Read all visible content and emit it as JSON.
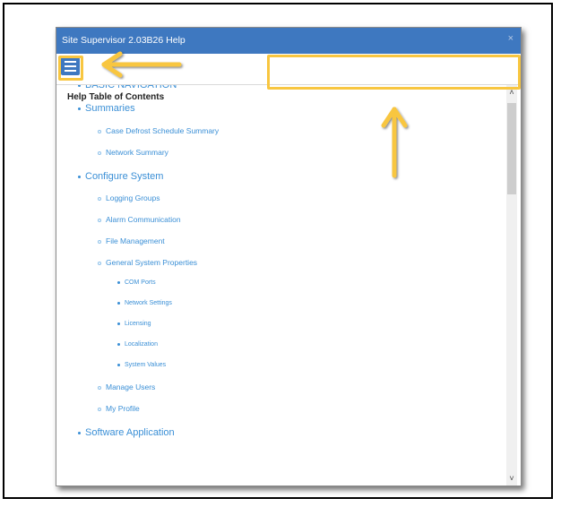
{
  "window": {
    "title": "Site Supervisor 2.03B26 Help",
    "close_label": "×"
  },
  "toolbar": {
    "menu_icon": "hamburger-menu-icon",
    "search_placeholder": "",
    "search_icon": "search-icon"
  },
  "toc": {
    "heading": "Help Table of Contents",
    "items": [
      {
        "level": 1,
        "label": "BASIC NAVIGATION"
      },
      {
        "level": 1,
        "label": "Summaries"
      },
      {
        "level": 2,
        "label": "Case Defrost Schedule Summary"
      },
      {
        "level": 2,
        "label": "Network Summary"
      },
      {
        "level": 1,
        "label": "Configure System"
      },
      {
        "level": 2,
        "label": "Logging Groups"
      },
      {
        "level": 2,
        "label": "Alarm Communication"
      },
      {
        "level": 2,
        "label": "File Management"
      },
      {
        "level": 2,
        "label": "General System Properties"
      },
      {
        "level": 3,
        "label": "COM Ports"
      },
      {
        "level": 3,
        "label": "Network Settings"
      },
      {
        "level": 3,
        "label": "Licensing"
      },
      {
        "level": 3,
        "label": "Localization"
      },
      {
        "level": 3,
        "label": "System Values"
      },
      {
        "level": 2,
        "label": "Manage Users"
      },
      {
        "level": 2,
        "label": "My Profile"
      },
      {
        "level": 1,
        "label": "Software Application"
      }
    ]
  },
  "scrollbar": {
    "up_icon": "chevron-up-icon",
    "down_icon": "chevron-down-icon",
    "up_glyph": "˄",
    "down_glyph": "˅"
  },
  "annotations": {
    "highlight_color": "#f8c640",
    "arrow_color": "#f8c640"
  },
  "colors": {
    "titlebar": "#3e78c0",
    "link": "#3a8fd6",
    "search_button": "#2e5f9c"
  }
}
